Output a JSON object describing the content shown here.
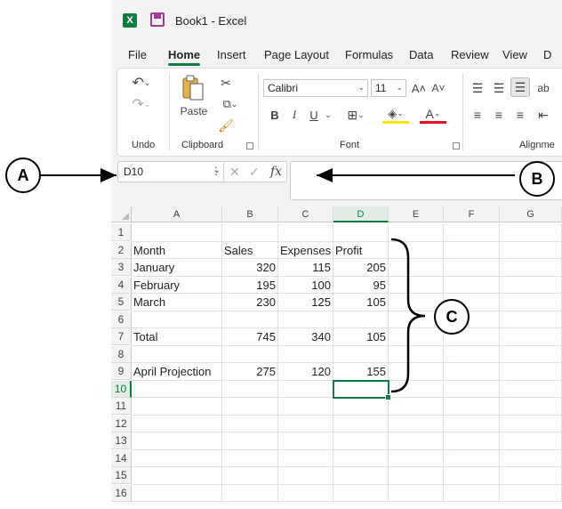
{
  "titlebar": {
    "app_icon": "X",
    "title": "Book1  -  Excel"
  },
  "menu_tabs": [
    "File",
    "Home",
    "Insert",
    "Page Layout",
    "Formulas",
    "Data",
    "Review",
    "View",
    "D"
  ],
  "ribbon": {
    "undo_group_label": "Undo",
    "clipboard_group_label": "Clipboard",
    "paste_label": "Paste",
    "font_group_label": "Font",
    "alignment_group_label": "Alignme",
    "font_name": "Calibri",
    "font_size": "11",
    "bold": "B",
    "italic": "I",
    "underline": "U",
    "grow_font": "A˄",
    "shrink_font": "A˅",
    "font_color_letter": "A"
  },
  "formula_bar": {
    "name_box": "D10",
    "fx": "fx",
    "formula": ""
  },
  "sheet": {
    "columns": [
      "A",
      "B",
      "C",
      "D",
      "E",
      "F",
      "G"
    ],
    "active_column": "D",
    "active_row": "10",
    "rows": [
      "1",
      "2",
      "3",
      "4",
      "5",
      "6",
      "7",
      "8",
      "9",
      "10",
      "11",
      "12",
      "13",
      "14",
      "15",
      "16"
    ],
    "data": [
      [
        "",
        "",
        "",
        ""
      ],
      [
        "Month",
        "Sales",
        "Expenses",
        "Profit"
      ],
      [
        "January",
        "320",
        "115",
        "205"
      ],
      [
        "February",
        "195",
        "100",
        "95"
      ],
      [
        "March",
        "230",
        "125",
        "105"
      ],
      [
        "",
        "",
        "",
        ""
      ],
      [
        "Total",
        "745",
        "340",
        "105"
      ],
      [
        "",
        "",
        "",
        ""
      ],
      [
        "April Projection",
        "275",
        "120",
        "155"
      ]
    ]
  },
  "callouts": {
    "a": "A",
    "b": "B",
    "c": "C"
  }
}
